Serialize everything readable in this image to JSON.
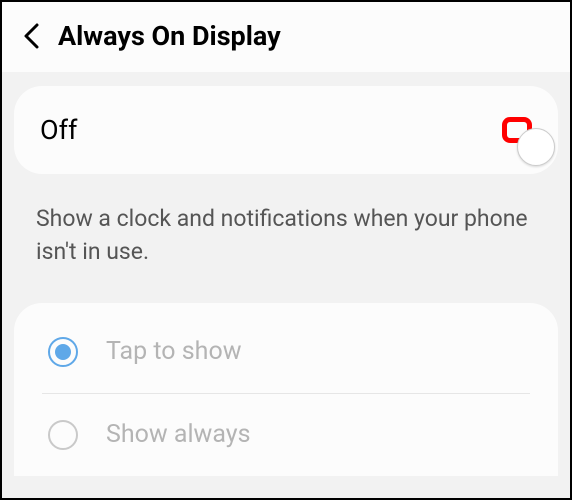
{
  "header": {
    "title": "Always On Display"
  },
  "toggle": {
    "label": "Off",
    "state": false
  },
  "description": "Show a clock and notifications when your phone isn't in use.",
  "options": [
    {
      "label": "Tap to show",
      "selected": true
    },
    {
      "label": "Show always",
      "selected": false
    }
  ]
}
